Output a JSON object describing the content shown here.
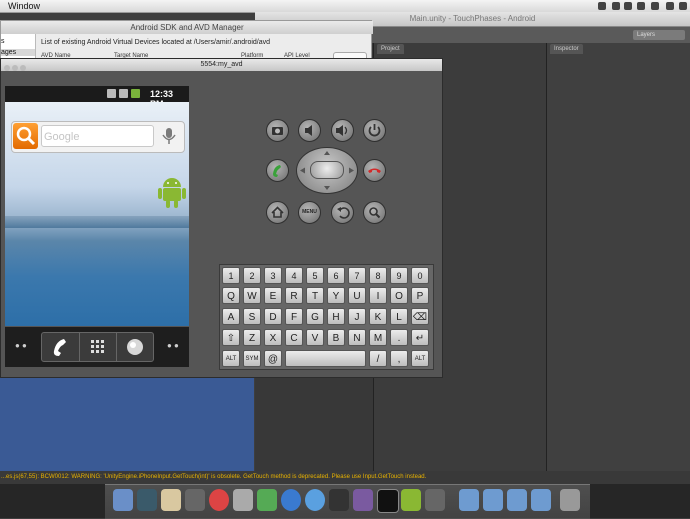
{
  "menubar": {
    "left_item": "Window"
  },
  "unity": {
    "title": "Main.unity - TouchPhases - Android",
    "layers": "Layers",
    "project_tab": "Project",
    "inspector_tab": "Inspector"
  },
  "avd_manager": {
    "title": "Android SDK and AVD Manager",
    "side_items": [
      "s",
      "ages"
    ],
    "caption": "List of existing Android Virtual Devices located at /Users/amir/.android/avd",
    "columns": [
      "AVD Name",
      "Target Name",
      "Platform",
      "API Level"
    ]
  },
  "emulator": {
    "title": "5554:my_avd",
    "clock": "12:33 PM",
    "search_placeholder": "Google",
    "keyboard": {
      "row1": [
        "1",
        "2",
        "3",
        "4",
        "5",
        "6",
        "7",
        "8",
        "9",
        "0"
      ],
      "row2": [
        "Q",
        "W",
        "E",
        "R",
        "T",
        "Y",
        "U",
        "I",
        "O",
        "P"
      ],
      "row3": [
        "A",
        "S",
        "D",
        "F",
        "G",
        "H",
        "J",
        "K",
        "L"
      ],
      "row4": [
        "Z",
        "X",
        "C",
        "V",
        "B",
        "N",
        "M",
        "."
      ],
      "row5": {
        "alt_left": "ALT",
        "sym": "SYM",
        "at": "@",
        "slash": "/",
        "comma": ",",
        "alt_right": "ALT"
      }
    },
    "icons": {
      "camera": "camera-icon",
      "volume_down": "volume-down-icon",
      "volume_up": "volume-up-icon",
      "power": "power-icon",
      "call": "call-icon",
      "end_call": "end-call-icon",
      "home": "home-icon",
      "menu": "MENU",
      "back": "back-icon",
      "search": "search-icon"
    },
    "colors": {
      "search_orange": "#f58b1f",
      "android_green": "#8ab833",
      "call_green": "#3aa23a",
      "end_red": "#d32a2a"
    }
  },
  "console": {
    "message": "...es.js(67,55): BCW0012: WARNING: 'UnityEngine.iPhoneInput.GetTouch(int)' is obsolete. GetTouch method is deprecated. Please use Input.GetTouch instead."
  }
}
